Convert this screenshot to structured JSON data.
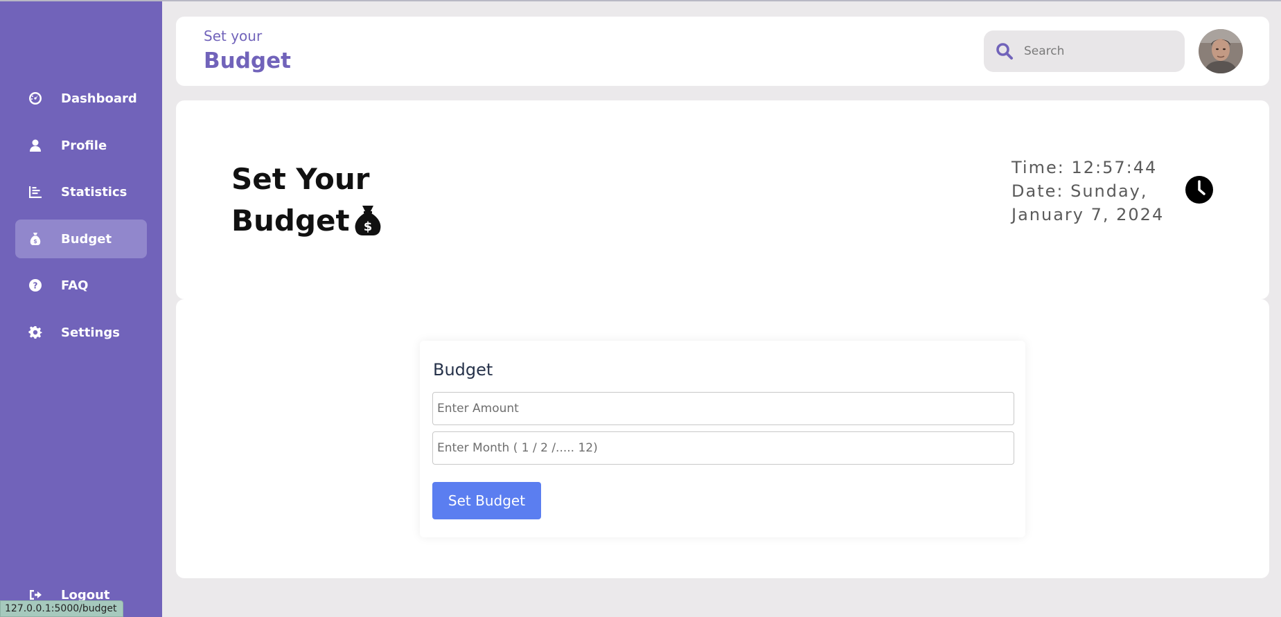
{
  "sidebar": {
    "items": [
      {
        "label": "Dashboard",
        "icon": "gauge-icon"
      },
      {
        "label": "Profile",
        "icon": "user-icon"
      },
      {
        "label": "Statistics",
        "icon": "chart-icon"
      },
      {
        "label": "Budget",
        "icon": "moneybag-icon",
        "active": true
      },
      {
        "label": "FAQ",
        "icon": "question-icon"
      },
      {
        "label": "Settings",
        "icon": "gear-icon"
      }
    ],
    "logout": "Logout"
  },
  "header": {
    "subtitle": "Set your",
    "title": "Budget",
    "search_placeholder": "Search"
  },
  "hero": {
    "title_line1": "Set Your",
    "title_line2": "Budget",
    "time": "Time: 12:57:44",
    "date_line1": "Date: Sunday,",
    "date_line2": "January 7, 2024"
  },
  "form": {
    "title": "Budget",
    "amount_placeholder": "Enter Amount",
    "month_placeholder": "Enter Month ( 1 / 2 /..... 12)",
    "submit_label": "Set Budget"
  },
  "status_bar": {
    "url": "127.0.0.1:5000/budget"
  },
  "colors": {
    "sidebar_bg": "#7163ba",
    "active_item_bg": "#9187cc",
    "page_bg": "#ebe9eb",
    "accent": "#7163ba",
    "button": "#5b7ef0"
  }
}
